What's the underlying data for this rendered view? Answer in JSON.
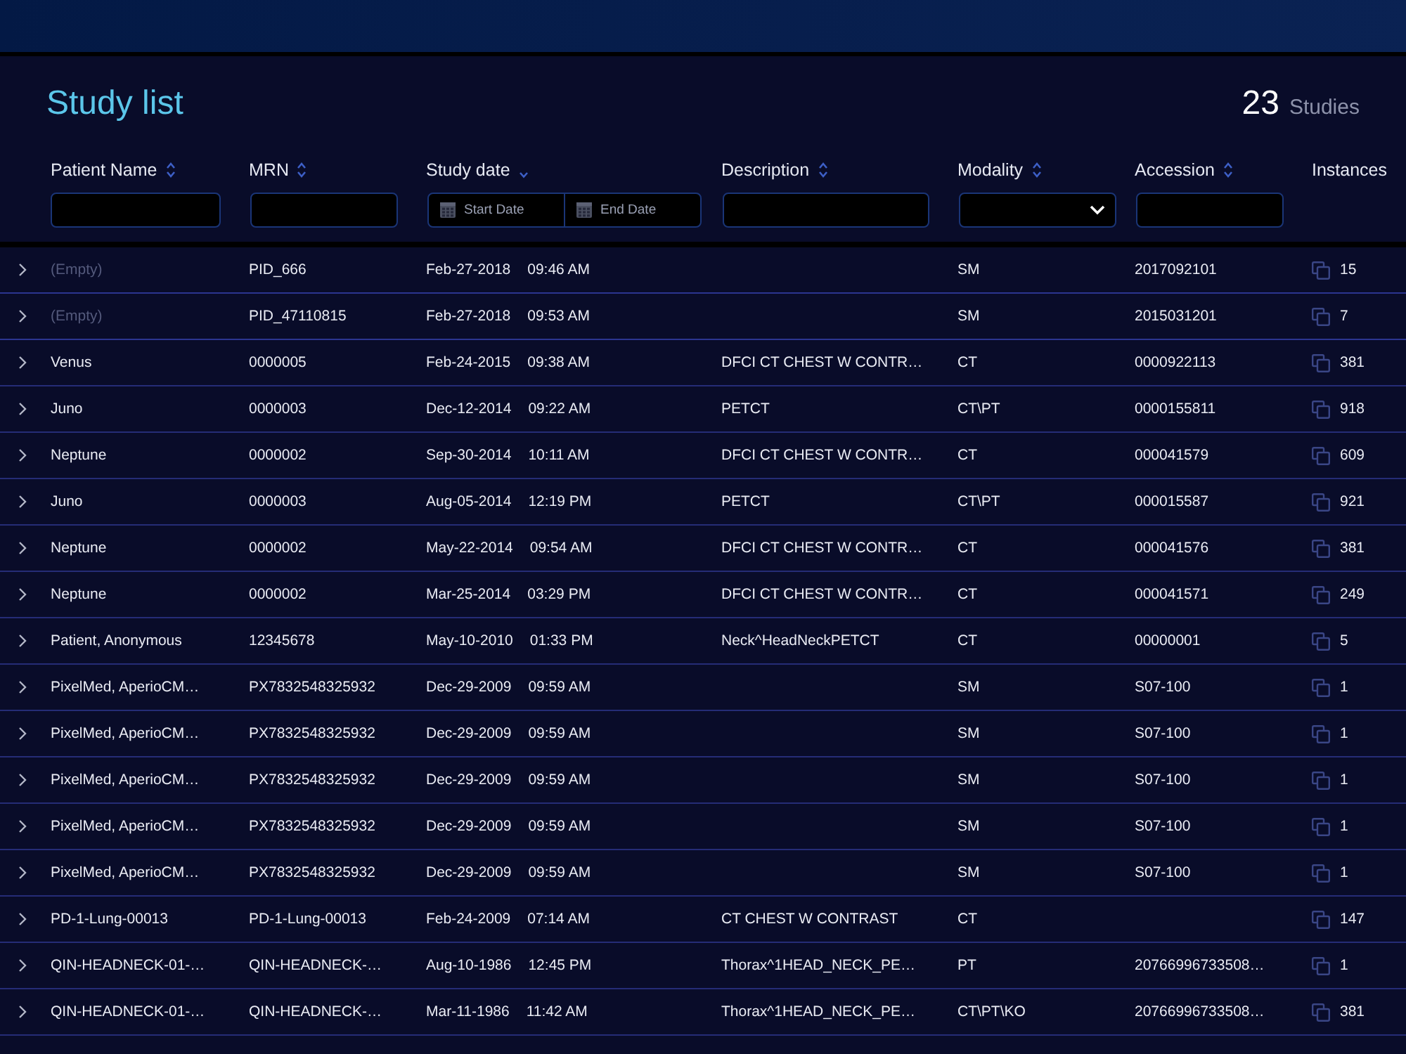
{
  "header": {
    "title": "Study list",
    "count": "23",
    "count_label": "Studies"
  },
  "columns": [
    {
      "label": "Patient Name",
      "sortable": true,
      "sorted": false,
      "kind": "text"
    },
    {
      "label": "MRN",
      "sortable": true,
      "sorted": false,
      "kind": "text"
    },
    {
      "label": "Study date",
      "sortable": true,
      "sorted": true,
      "kind": "daterange",
      "start_placeholder": "Start Date",
      "end_placeholder": "End Date"
    },
    {
      "label": "Description",
      "sortable": true,
      "sorted": false,
      "kind": "text"
    },
    {
      "label": "Modality",
      "sortable": true,
      "sorted": false,
      "kind": "select"
    },
    {
      "label": "Accession",
      "sortable": true,
      "sorted": false,
      "kind": "text"
    },
    {
      "label": "Instances",
      "sortable": false,
      "sorted": false,
      "kind": "plain"
    }
  ],
  "rows": [
    {
      "name": "(Empty)",
      "name_empty": true,
      "mrn": "PID_666",
      "date": "Feb-27-2018",
      "time": "09:46 AM",
      "modality": "SM",
      "accession": "2017092101",
      "instances": "15"
    },
    {
      "name": "(Empty)",
      "name_empty": true,
      "mrn": "PID_47110815",
      "date": "Feb-27-2018",
      "time": "09:53 AM",
      "modality": "SM",
      "accession": "2015031201",
      "instances": "7"
    },
    {
      "name": "Venus",
      "name_empty": false,
      "mrn": "0000005",
      "date": "Feb-24-2015",
      "time": "09:38 AM",
      "description": "DFCI CT CHEST W CONTR…",
      "modality": "CT",
      "accession": "0000922113",
      "instances": "381"
    },
    {
      "name": "Juno",
      "name_empty": false,
      "mrn": "0000003",
      "date": "Dec-12-2014",
      "time": "09:22 AM",
      "description": "PETCT",
      "modality": "CT\\PT",
      "accession": "0000155811",
      "instances": "918"
    },
    {
      "name": "Neptune",
      "name_empty": false,
      "mrn": "0000002",
      "date": "Sep-30-2014",
      "time": "10:11 AM",
      "description": "DFCI CT CHEST W CONTR…",
      "modality": "CT",
      "accession": "000041579",
      "instances": "609"
    },
    {
      "name": "Juno",
      "name_empty": false,
      "mrn": "0000003",
      "date": "Aug-05-2014",
      "time": "12:19 PM",
      "description": "PETCT",
      "modality": "CT\\PT",
      "accession": "000015587",
      "instances": "921"
    },
    {
      "name": "Neptune",
      "name_empty": false,
      "mrn": "0000002",
      "date": "May-22-2014",
      "time": "09:54 AM",
      "description": "DFCI CT CHEST W CONTR…",
      "modality": "CT",
      "accession": "000041576",
      "instances": "381"
    },
    {
      "name": "Neptune",
      "name_empty": false,
      "mrn": "0000002",
      "date": "Mar-25-2014",
      "time": "03:29 PM",
      "description": "DFCI CT CHEST W CONTR…",
      "modality": "CT",
      "accession": "000041571",
      "instances": "249"
    },
    {
      "name": "Patient, Anonymous",
      "name_empty": false,
      "mrn": "12345678",
      "date": "May-10-2010",
      "time": "01:33 PM",
      "description": "Neck^HeadNeckPETCT",
      "modality": "CT",
      "accession": "00000001",
      "instances": "5"
    },
    {
      "name": "PixelMed, AperioCM…",
      "name_empty": false,
      "mrn": "PX7832548325932",
      "date": "Dec-29-2009",
      "time": "09:59 AM",
      "modality": "SM",
      "accession": "S07-100",
      "instances": "1"
    },
    {
      "name": "PixelMed, AperioCM…",
      "name_empty": false,
      "mrn": "PX7832548325932",
      "date": "Dec-29-2009",
      "time": "09:59 AM",
      "modality": "SM",
      "accession": "S07-100",
      "instances": "1"
    },
    {
      "name": "PixelMed, AperioCM…",
      "name_empty": false,
      "mrn": "PX7832548325932",
      "date": "Dec-29-2009",
      "time": "09:59 AM",
      "modality": "SM",
      "accession": "S07-100",
      "instances": "1"
    },
    {
      "name": "PixelMed, AperioCM…",
      "name_empty": false,
      "mrn": "PX7832548325932",
      "date": "Dec-29-2009",
      "time": "09:59 AM",
      "modality": "SM",
      "accession": "S07-100",
      "instances": "1"
    },
    {
      "name": "PixelMed, AperioCM…",
      "name_empty": false,
      "mrn": "PX7832548325932",
      "date": "Dec-29-2009",
      "time": "09:59 AM",
      "modality": "SM",
      "accession": "S07-100",
      "instances": "1"
    },
    {
      "name": "PD-1-Lung-00013",
      "name_empty": false,
      "mrn": "PD-1-Lung-00013",
      "date": "Feb-24-2009",
      "time": "07:14 AM",
      "description": "CT CHEST W CONTRAST",
      "modality": "CT",
      "instances": "147"
    },
    {
      "name": "QIN-HEADNECK-01-…",
      "name_empty": false,
      "mrn": "QIN-HEADNECK-…",
      "date": "Aug-10-1986",
      "time": "12:45 PM",
      "description": "Thorax^1HEAD_NECK_PE…",
      "modality": "PT",
      "accession": "20766996733508…",
      "instances": "1"
    },
    {
      "name": "QIN-HEADNECK-01-…",
      "name_empty": false,
      "mrn": "QIN-HEADNECK-…",
      "date": "Mar-11-1986",
      "time": "11:42 AM",
      "description": "Thorax^1HEAD_NECK_PE…",
      "modality": "CT\\PT\\KO",
      "accession": "20766996733508…",
      "instances": "381"
    }
  ]
}
